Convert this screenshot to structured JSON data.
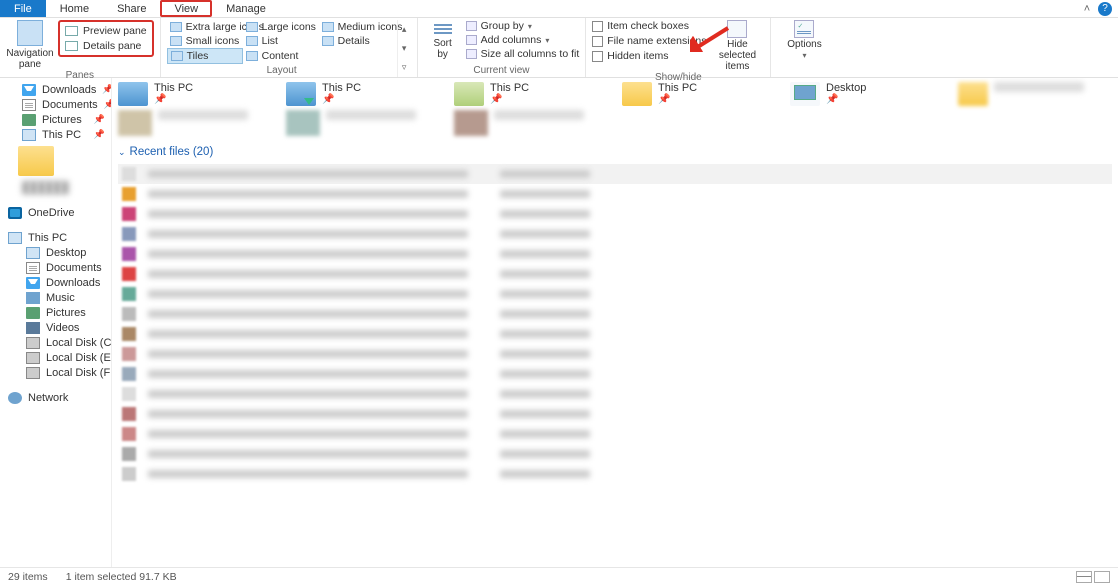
{
  "tabs": {
    "file": "File",
    "home": "Home",
    "share": "Share",
    "view": "View",
    "manage": "Manage"
  },
  "ribbon": {
    "panes": {
      "nav_pane": "Navigation\npane",
      "preview_pane": "Preview pane",
      "details_pane": "Details pane",
      "group_label": "Panes"
    },
    "layout": {
      "xl": "Extra large icons",
      "lg": "Large icons",
      "md": "Medium icons",
      "sm": "Small icons",
      "list": "List",
      "details": "Details",
      "tiles": "Tiles",
      "content": "Content",
      "group_label": "Layout"
    },
    "current_view": {
      "sort_by": "Sort\nby",
      "group_by": "Group by",
      "add_columns": "Add columns",
      "size_all": "Size all columns to fit",
      "group_label": "Current view"
    },
    "show_hide": {
      "item_check": "Item check boxes",
      "file_ext": "File name extensions",
      "hidden": "Hidden items",
      "hide_selected": "Hide selected\nitems",
      "group_label": "Show/hide"
    },
    "options": "Options"
  },
  "sidebar": {
    "quick": {
      "downloads": "Downloads",
      "documents": "Documents",
      "pictures": "Pictures",
      "this_pc": "This PC"
    },
    "onedrive": "OneDrive",
    "this_pc": "This PC",
    "children": {
      "desktop": "Desktop",
      "documents": "Documents",
      "downloads": "Downloads",
      "music": "Music",
      "pictures": "Pictures",
      "videos": "Videos",
      "disk_c": "Local Disk (C:)",
      "disk_e": "Local Disk (E:)",
      "disk_f": "Local Disk (F:)"
    },
    "network": "Network"
  },
  "content": {
    "qa_sub": "This PC",
    "desktop_label": "Desktop",
    "recent_header": "Recent files (20)"
  },
  "status": {
    "items": "29 items",
    "selected": "1 item selected  91.7 KB"
  }
}
